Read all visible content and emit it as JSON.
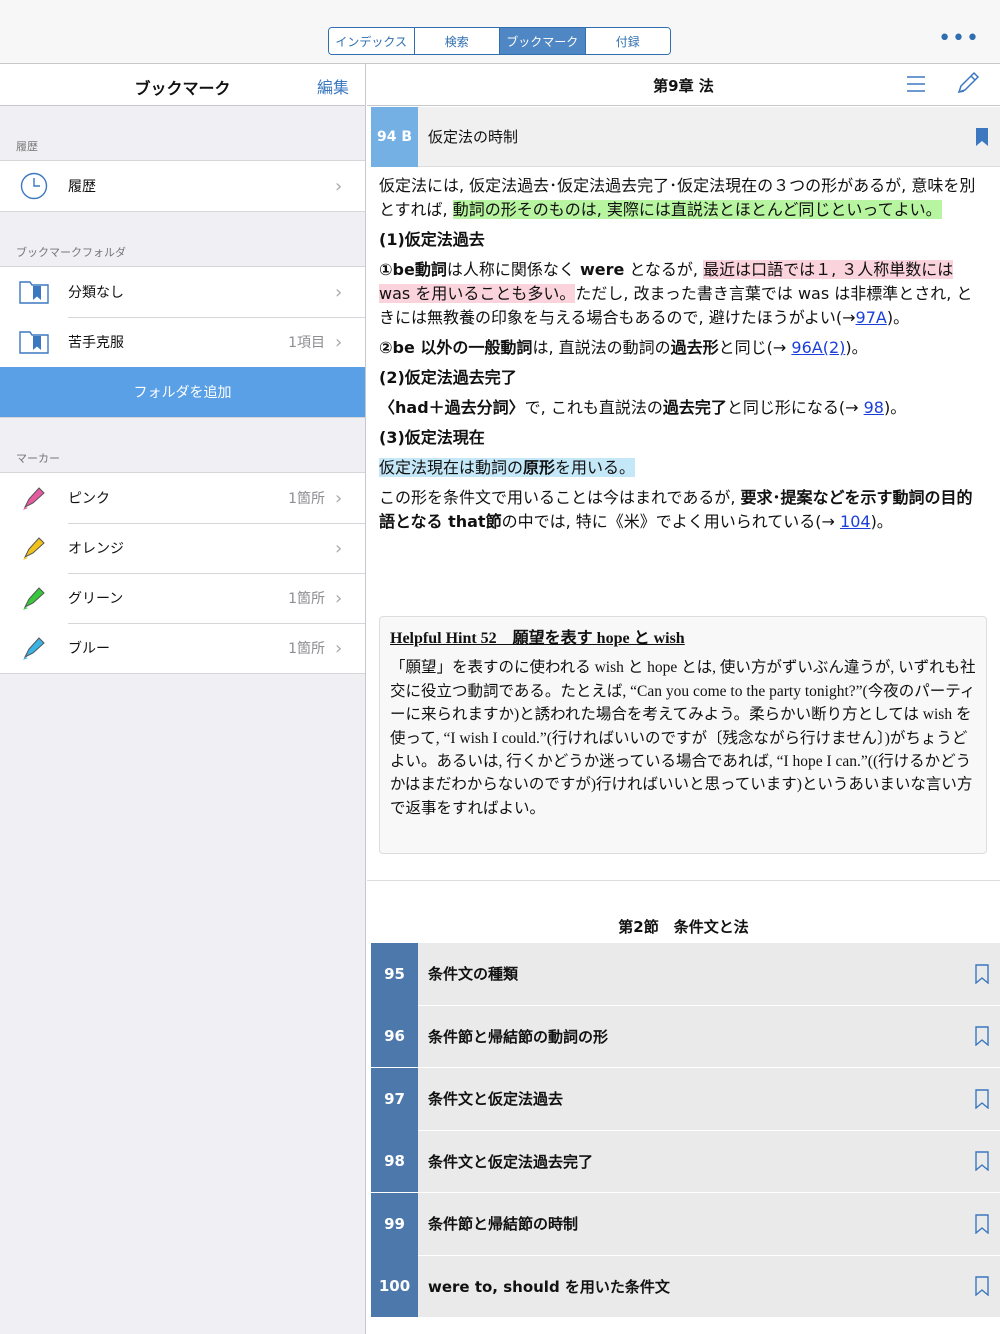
{
  "top_tabs": [
    "インデックス",
    "検索",
    "ブックマーク",
    "付録"
  ],
  "active_tab_index": 2,
  "more_label": "•••",
  "left": {
    "title": "ブックマーク",
    "edit_label": "編集",
    "history_section": "履歴",
    "history_item": "履歴",
    "folder_section": "ブックマークフォルダ",
    "folders": [
      {
        "label": "分類なし",
        "count": ""
      },
      {
        "label": "苦手克服",
        "count": "1項目"
      }
    ],
    "add_folder": "フォルダを追加",
    "marker_section": "マーカー",
    "markers": [
      {
        "label": "ピンク",
        "count": "1箇所",
        "color": "#e85aa0"
      },
      {
        "label": "オレンジ",
        "count": "",
        "color": "#f2c21b"
      },
      {
        "label": "グリーン",
        "count": "1箇所",
        "color": "#37c93a"
      },
      {
        "label": "ブルー",
        "count": "1箇所",
        "color": "#3ab3e6"
      }
    ],
    "chevron": "›"
  },
  "right": {
    "chapter": "第9章 法",
    "section_num": "94 B",
    "section_title": "仮定法の時制",
    "p1_a": "仮定法には, 仮定法過去･仮定法過去完了･仮定法現在の３つの形があるが, 意味を別とすれば, ",
    "p1_hl": "動詞の形そのものは, 実際には直説法とほとんど同じといってよい。",
    "h1": "(1)仮定法過去",
    "p2_a": "①be動詞",
    "p2_b": "は人称に関係なく ",
    "p2_c": "were",
    "p2_d": " となるが, ",
    "p2_hl": "最近は口語では１, ３人称単数には was を用いることも多い。",
    "p2_e": "ただし, 改まった書き言葉では was は非標準とされ, ときには無教養の印象を与える場合もあるので, 避けたほうがよい(→",
    "p2_link": "97A",
    "p2_f": ")。",
    "p3_a": "②be 以外の一般動詞",
    "p3_b": "は, 直説法の動詞の",
    "p3_c": "過去形",
    "p3_d": "と同じ(→ ",
    "p3_link": "96A(2)",
    "p3_e": ")。",
    "h2": "(2)仮定法過去完了",
    "p4_a": "〈had＋過去分詞〉",
    "p4_b": "で, これも直説法の",
    "p4_c": "過去完了",
    "p4_d": "と同じ形になる(→ ",
    "p4_link": "98",
    "p4_e": ")。",
    "h3": "(3)仮定法現在",
    "p5_hl_a": "仮定法現在は動詞の",
    "p5_hl_b": "原形",
    "p5_hl_c": "を用いる。",
    "p6_a": "この形を条件文で用いることは今はまれであるが, ",
    "p6_b": "要求･提案などを示す動詞の目的語となる that節",
    "p6_c": "の中では, 特に《米》でよく用いられている(→ ",
    "p6_link": "104",
    "p6_d": ")。",
    "hint_title": "Helpful Hint 52　願望を表す hope と wish",
    "hint_body": "「願望」を表すのに使われる wish と hope とは, 使い方がずいぶん違うが, いずれも社交に役立つ動詞である。たとえば, “Can you come to the party tonight?”(今夜のパーティーに来られますか)と誘われた場合を考えてみよう。柔らかい断り方としては wish を使って, “I wish I could.”(行ければいいのですが〔残念ながら行けません〕)がちょうどよい。あるいは, 行くかどうか迷っている場合であれば, “I hope I can.”((行けるかどうかはまだわからないのですが)行ければいいと思っています)というあいまいな言い方で返事をすればよい。",
    "section2": "第2節　条件文と法",
    "toc": [
      {
        "num": "95",
        "title": "条件文の種類"
      },
      {
        "num": "96",
        "title": "条件節と帰結節の動詞の形"
      },
      {
        "num": "97",
        "title": "条件文と仮定法過去"
      },
      {
        "num": "98",
        "title": "条件文と仮定法過去完了"
      },
      {
        "num": "99",
        "title": "条件節と帰結節の時制"
      },
      {
        "num": "100",
        "title": "were to, should を用いた条件文"
      }
    ]
  }
}
